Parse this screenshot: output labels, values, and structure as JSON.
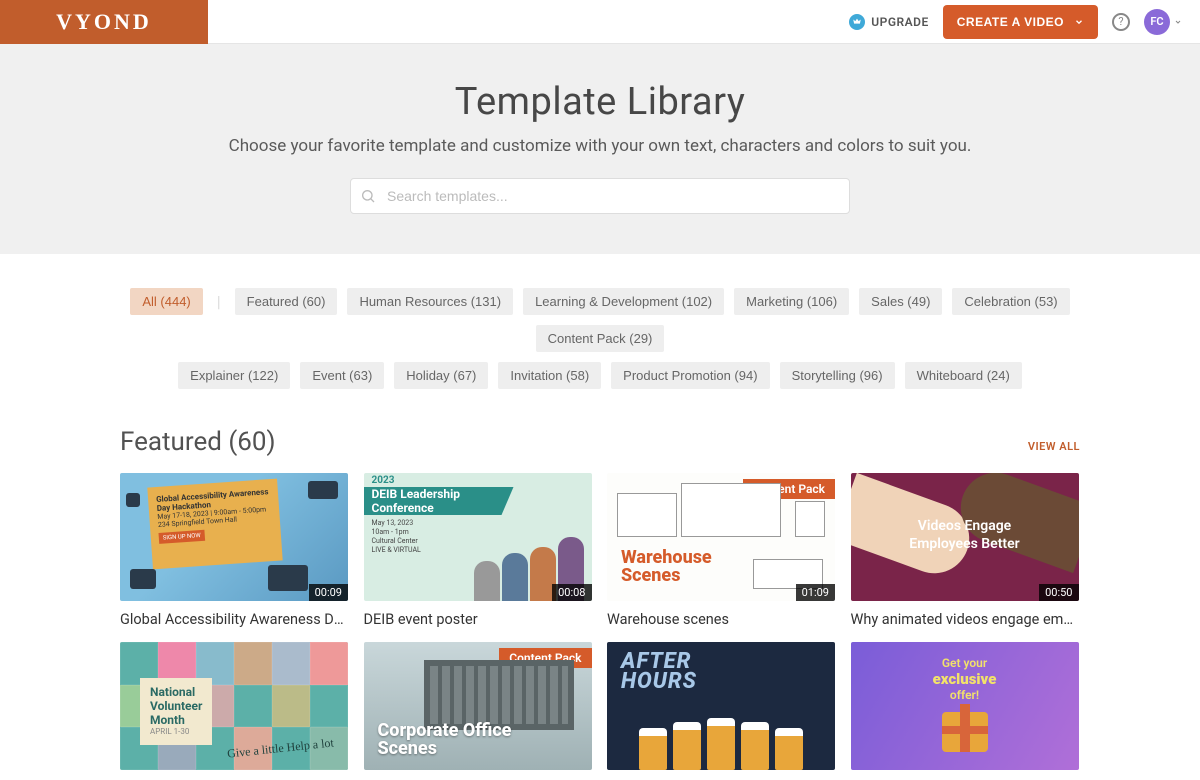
{
  "header": {
    "logo": "VYOND",
    "upgrade": "UPGRADE",
    "create": "CREATE A VIDEO",
    "avatar": "FC"
  },
  "hero": {
    "title": "Template Library",
    "subtitle": "Choose your favorite template and customize with your own text, characters and colors to suit you.",
    "search_placeholder": "Search templates..."
  },
  "filters_row1": [
    {
      "label": "All (444)",
      "active": true
    },
    {
      "label": "Featured (60)"
    },
    {
      "label": "Human Resources (131)"
    },
    {
      "label": "Learning & Development (102)"
    },
    {
      "label": "Marketing (106)"
    },
    {
      "label": "Sales (49)"
    },
    {
      "label": "Celebration (53)"
    },
    {
      "label": "Content Pack (29)"
    }
  ],
  "filters_row2": [
    {
      "label": "Explainer (122)"
    },
    {
      "label": "Event (63)"
    },
    {
      "label": "Holiday (67)"
    },
    {
      "label": "Invitation (58)"
    },
    {
      "label": "Product Promotion (94)"
    },
    {
      "label": "Storytelling (96)"
    },
    {
      "label": "Whiteboard (24)"
    }
  ],
  "section": {
    "title": "Featured (60)",
    "viewall": "VIEW ALL"
  },
  "cards": [
    {
      "title": "Global Accessibility Awareness Day ev...",
      "duration": "00:09",
      "badge": null
    },
    {
      "title": "DEIB event poster",
      "duration": "00:08",
      "badge": null
    },
    {
      "title": "Warehouse scenes",
      "duration": "01:09",
      "badge": "Content Pack"
    },
    {
      "title": "Why animated videos engage employe...",
      "duration": "00:50",
      "badge": null
    },
    {
      "title": "",
      "duration": "",
      "badge": null
    },
    {
      "title": "",
      "duration": "",
      "badge": "Content Pack"
    },
    {
      "title": "",
      "duration": "",
      "badge": null
    },
    {
      "title": "",
      "duration": "",
      "badge": null
    }
  ],
  "thumb_text": {
    "t1_head": "Global Accessibility Awareness Day Hackathon",
    "t1_sub": "May 17-18, 2023 | 9:00am - 5:00pm\n234 Springfield Town Hall",
    "t1_btn": "SIGN UP NOW",
    "t2_year": "2023",
    "t2_bar": "DEIB Leadership Conference",
    "t2_small": "May 13, 2023\n10am - 1pm\nCultural Center\nLIVE & VIRTUAL",
    "t3_a": "Warehouse",
    "t3_b": "Scenes",
    "t4_a": "Videos Engage",
    "t4_b": "Employees Better",
    "t5_a": "National",
    "t5_b": "Volunteer",
    "t5_c": "Month",
    "t5_d": "APRIL 1-30",
    "t5_e": "Give a little Help a lot",
    "t6_a": "Corporate Office",
    "t6_b": "Scenes",
    "t7": "AFTER\nHOURS",
    "t8_a": "Get your",
    "t8_b": "exclusive",
    "t8_c": "offer!"
  }
}
